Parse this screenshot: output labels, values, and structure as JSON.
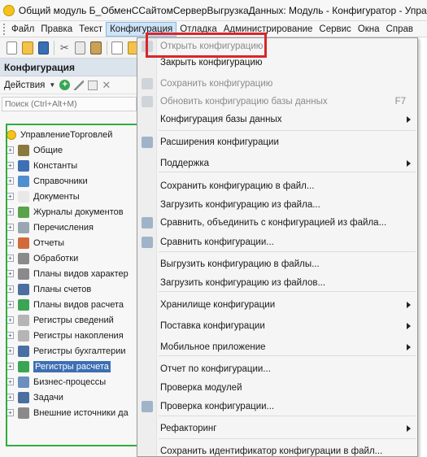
{
  "window": {
    "title": "Общий модуль Б_ОбменССайтомСерверВыгрузкаДанных: Модуль - Конфигуратор - Управ"
  },
  "menubar": {
    "items": [
      "Файл",
      "Правка",
      "Текст",
      "Конфигурация",
      "Отладка",
      "Администрирование",
      "Сервис",
      "Окна",
      "Справ"
    ],
    "active_index": 3
  },
  "left_panel": {
    "title": "Конфигурация",
    "actions_label": "Действия",
    "search_placeholder": "Поиск (Ctrl+Alt+M)",
    "tree_root": "УправлениеТорговлей",
    "tree_items": [
      {
        "label": "Общие",
        "icon": "general-icon",
        "color": "#8a7a3e"
      },
      {
        "label": "Константы",
        "icon": "constants-icon",
        "color": "#3e6fb5"
      },
      {
        "label": "Справочники",
        "icon": "catalogs-icon",
        "color": "#4f8fcf"
      },
      {
        "label": "Документы",
        "icon": "documents-icon",
        "color": "#e8e8e8"
      },
      {
        "label": "Журналы документов",
        "icon": "journals-icon",
        "color": "#5aa34a"
      },
      {
        "label": "Перечисления",
        "icon": "enums-icon",
        "color": "#9aa6b2"
      },
      {
        "label": "Отчеты",
        "icon": "reports-icon",
        "color": "#d26b3a"
      },
      {
        "label": "Обработки",
        "icon": "processing-icon",
        "color": "#8a8a8a"
      },
      {
        "label": "Планы видов характер",
        "icon": "characteristic-types-icon",
        "color": "#8a8a8a"
      },
      {
        "label": "Планы счетов",
        "icon": "accounts-chart-icon",
        "color": "#4a6fa0"
      },
      {
        "label": "Планы видов расчета",
        "icon": "calculation-types-icon",
        "color": "#3aa655"
      },
      {
        "label": "Регистры сведений",
        "icon": "info-registers-icon",
        "color": "#b5b5b5"
      },
      {
        "label": "Регистры накопления",
        "icon": "accumulation-registers-icon",
        "color": "#b5b5b5"
      },
      {
        "label": "Регистры бухгалтерии",
        "icon": "accounting-registers-icon",
        "color": "#4a6fa0"
      },
      {
        "label": "Регистры расчета",
        "icon": "calculation-registers-icon",
        "color": "#3aa655",
        "selected": true
      },
      {
        "label": "Бизнес-процессы",
        "icon": "business-processes-icon",
        "color": "#6b8fbf"
      },
      {
        "label": "Задачи",
        "icon": "tasks-icon",
        "color": "#4a6fa0"
      },
      {
        "label": "Внешние источники да",
        "icon": "external-sources-icon",
        "color": "#8a8a8a"
      }
    ]
  },
  "menu": {
    "items": [
      {
        "label": "Открыть конфигурацию",
        "disabled": true,
        "icon": "open-config-icon"
      },
      {
        "label": "Закрыть конфигурацию",
        "disabled": false
      },
      {
        "label": "Сохранить конфигурацию",
        "disabled": true,
        "icon": "save-config-icon"
      },
      {
        "label": "Обновить конфигурацию базы данных",
        "disabled": true,
        "shortcut": "F7",
        "icon": "update-db-icon"
      },
      {
        "label": "Конфигурация базы данных",
        "submenu": true
      },
      {
        "label": "Расширения конфигурации",
        "icon": "extensions-icon"
      },
      {
        "label": "Поддержка",
        "submenu": true
      },
      {
        "label": "Сохранить конфигурацию в файл..."
      },
      {
        "label": "Загрузить конфигурацию из файла..."
      },
      {
        "label": "Сравнить, объединить с конфигурацией из файла...",
        "icon": "compare-icon"
      },
      {
        "label": "Сравнить конфигурации...",
        "icon": "compare-configs-icon"
      },
      {
        "label": "Выгрузить конфигурацию в файлы..."
      },
      {
        "label": "Загрузить конфигурацию из файлов..."
      },
      {
        "label": "Хранилище конфигурации",
        "submenu": true
      },
      {
        "label": "Поставка конфигурации",
        "submenu": true
      },
      {
        "label": "Мобильное приложение",
        "submenu": true
      },
      {
        "label": "Отчет по конфигурации..."
      },
      {
        "label": "Проверка модулей"
      },
      {
        "label": "Проверка конфигурации...",
        "icon": "check-config-icon"
      },
      {
        "label": "Рефакторинг",
        "submenu": true
      },
      {
        "label": "Сохранить идентификатор конфигурации в файл..."
      }
    ]
  },
  "colors": {
    "highlight_red": "#d8262b",
    "highlight_green": "#2fae3c",
    "selection": "#3d6fb3",
    "active_menu": "#cfe3f6"
  }
}
